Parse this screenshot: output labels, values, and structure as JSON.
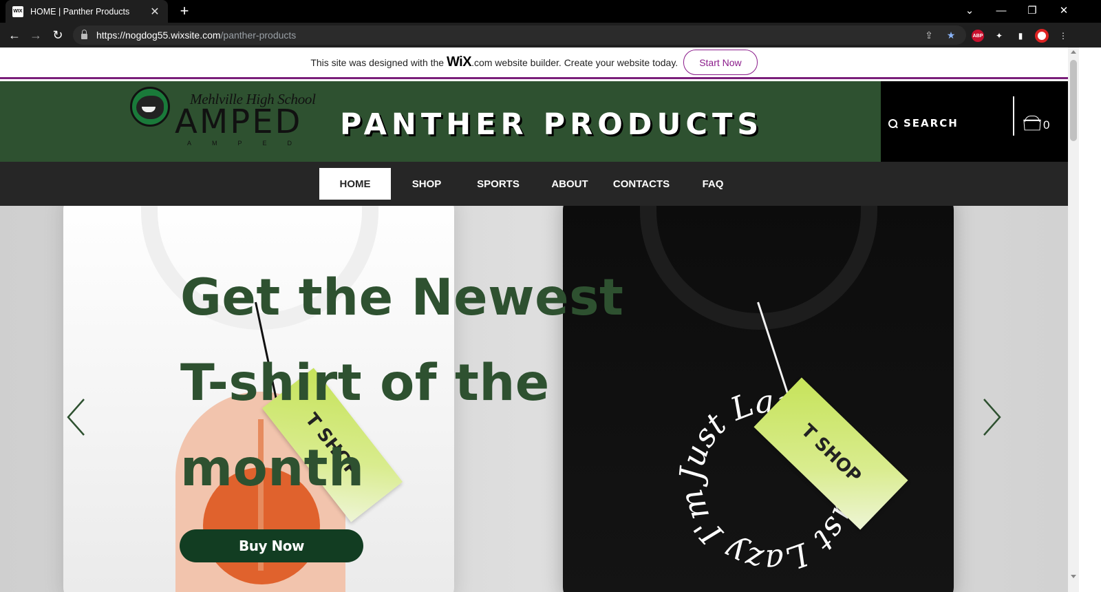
{
  "browser": {
    "tab_title": "HOME | Panther Products",
    "tab_favicon": "WIX",
    "new_tab": "+",
    "url_host": "https://nogdog55.wixsite.com",
    "url_path": "/panther-products",
    "window_controls": [
      "chevron-down-icon",
      "minimize-icon",
      "restore-icon",
      "close-icon"
    ],
    "extensions": {
      "abp": "ABP"
    }
  },
  "wix_banner": {
    "text_before": "This site was designed with the ",
    "logo": "WiX",
    "text_after": ".com website builder. Create your website today.",
    "button": "Start Now",
    "accent": "#8a1a8a"
  },
  "header": {
    "logo_school": "Mehlville High School",
    "logo_amped": "AMPED",
    "logo_amped_sub": "AMPED",
    "title": "PANTHER PRODUCTS",
    "search_label": "SEARCH",
    "cart_count": "0",
    "bg_color": "#2e5130"
  },
  "nav": {
    "items": [
      "HOME",
      "SHOP",
      "SPORTS",
      "ABOUT",
      "CONTACTS",
      "FAQ"
    ],
    "active": "HOME"
  },
  "hero": {
    "headline": "Get the Newest T-shirt of the month",
    "button": "Buy Now",
    "tag_text_1": "T SHOP",
    "tag_text_2": "T SHOP",
    "shirt_print_text": "Just Lazy I'm Just Lazy I'm",
    "headline_color": "#2e5130",
    "button_color": "#123d22"
  }
}
